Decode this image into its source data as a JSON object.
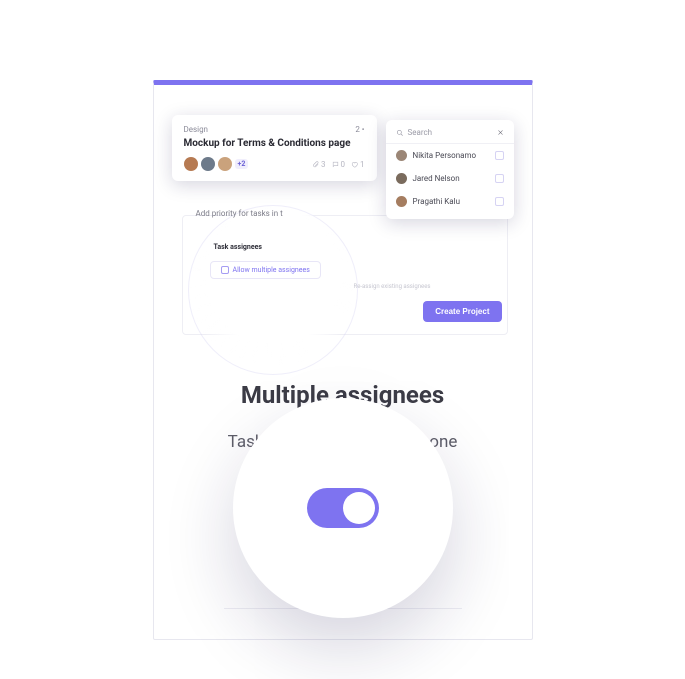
{
  "colors": {
    "accent": "#7e73f0"
  },
  "task_card": {
    "category": "Design",
    "badge": "2 •",
    "title": "Mockup for Terms & Conditions page",
    "more_count": "+2",
    "meta": {
      "attach": "3",
      "comments": "0",
      "likes": "1"
    }
  },
  "search": {
    "placeholder": "Search",
    "people": [
      {
        "name": "Nikita Personamo"
      },
      {
        "name": "Jared Nelson"
      },
      {
        "name": "Pragathi Kalu"
      }
    ]
  },
  "preview": {
    "floating_text": "Add priority for tasks in t",
    "section_label": "Task assignees",
    "allow_label": "Allow multiple assignees",
    "dim_hint": "Re-assign existing assignees",
    "create_label": "Create Project"
  },
  "content": {
    "heading": "Multiple assignees",
    "body": "Tasks can have more than one assignee."
  },
  "toggle": {
    "on": true
  }
}
